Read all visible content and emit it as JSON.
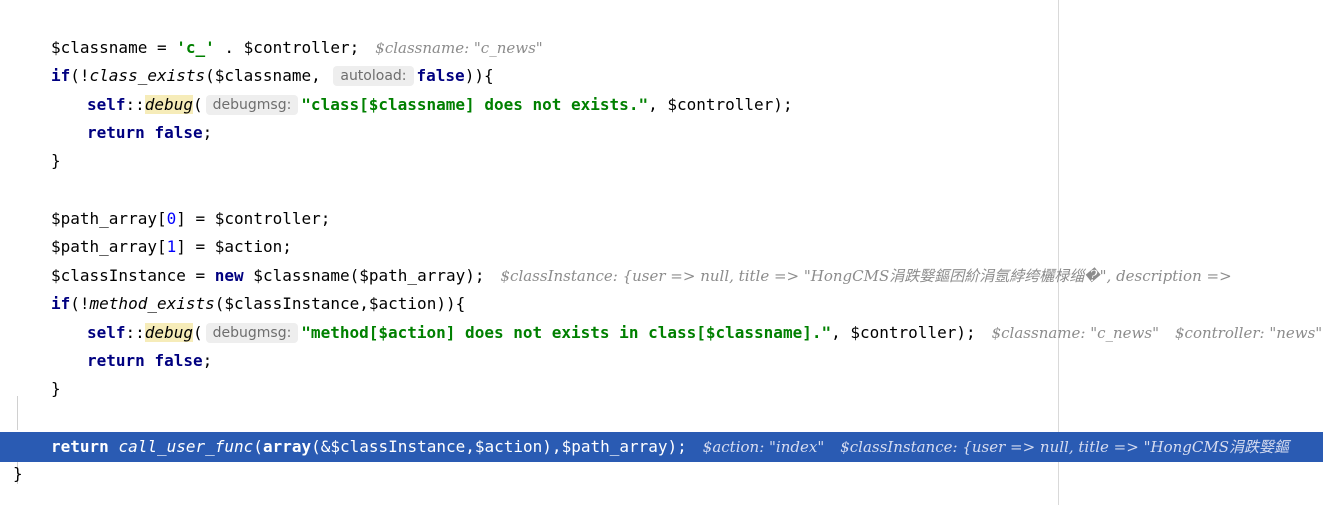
{
  "code": {
    "l1": {
      "var": "$classname",
      "eq": " = ",
      "str": "'c_'",
      "dot": " . ",
      "ctrl": "$controller",
      "semi": ";",
      "inlay": "$classname: \"c_news\""
    },
    "l2": {
      "kw": "if",
      "open": "(!",
      "fn": "class_exists",
      "args": "($classname, ",
      "hint": "autoload:",
      "val": "false",
      "close": ")){"
    },
    "l3": {
      "self": "self",
      "colons": "::",
      "fn": "debug",
      "paren": "(",
      "hint": "debugmsg:",
      "str": "\"class[$classname] does not exists.\"",
      "rest": ", $controller);"
    },
    "l4": {
      "kw": "return",
      "val": "false",
      "semi": ";"
    },
    "l5": {
      "brace": "}"
    },
    "l6": {
      "var": "$path_array",
      "lb": "[",
      "idx": "0",
      "rest": "] = $controller;"
    },
    "l7": {
      "var": "$path_array",
      "lb": "[",
      "idx": "1",
      "rest": "] = $action;"
    },
    "l8": {
      "var": "$classInstance = ",
      "kw": "new",
      "rest": " $classname($path_array);",
      "inlay": "$classInstance: {user => null, title => \"HongCMS涓跌嫛鏂囨紒涓氬綍绔欐椂缁�\", description =>"
    },
    "l9": {
      "kw": "if",
      "open": "(!",
      "fn": "method_exists",
      "args": "($classInstance,$action)){"
    },
    "l10": {
      "self": "self",
      "colons": "::",
      "fn": "debug",
      "paren": "(",
      "hint": "debugmsg:",
      "str": "\"method[$action] does not exists in class[$classname].\"",
      "rest": ", $controller);",
      "inlay1": "$classname: \"c_news\"",
      "inlay2": "$controller: \"news\""
    },
    "l11": {
      "kw": "return",
      "val": "false",
      "semi": ";"
    },
    "l12": {
      "brace": "}"
    },
    "l13": {
      "kw": "return",
      "fn": "call_user_func",
      "paren": "(",
      "arr": "array",
      "rest": "(&$classInstance,$action),$path_array);",
      "inlay1": "$action: \"index\"",
      "inlay2": "$classInstance: {user => null, title => \"HongCMS涓跌嫛鏂"
    },
    "l14": {
      "brace": "}"
    }
  }
}
